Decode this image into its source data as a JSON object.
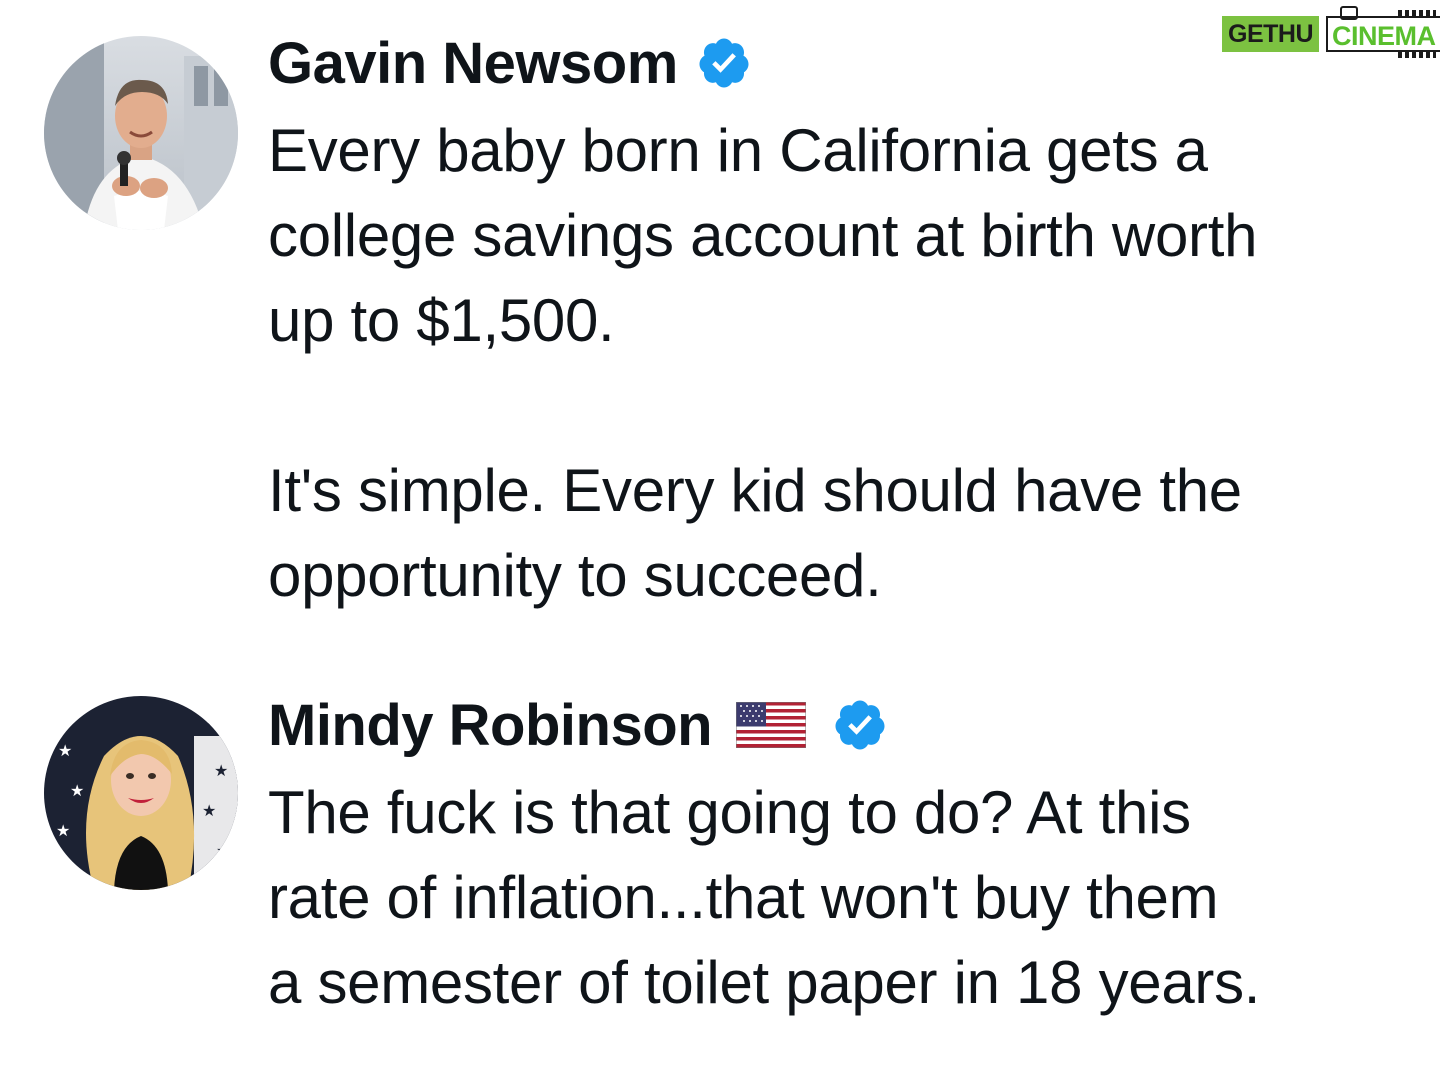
{
  "watermark": {
    "part1": "GETHU",
    "part2": "CINEMA"
  },
  "tweets": [
    {
      "author": "Gavin Newsom",
      "verified": true,
      "flag": null,
      "avatar": "portrait-man-with-microphone",
      "lines": [
        "Every baby born in California gets a",
        "college savings account at birth worth",
        "up to $1,500.",
        "",
        "It's simple. Every kid should have the",
        "opportunity to succeed."
      ]
    },
    {
      "author": "Mindy Robinson",
      "verified": true,
      "flag": "us-flag-emoji",
      "avatar": "portrait-blonde-woman-stars-background",
      "lines": [
        "The fuck is that going to do? At this",
        "rate of inflation...that won't buy them",
        "a semester of toilet paper in 18 years."
      ]
    }
  ],
  "colors": {
    "text": "#0f1419",
    "verified_blue": "#1d9bf0",
    "watermark_green": "#7cc241"
  }
}
